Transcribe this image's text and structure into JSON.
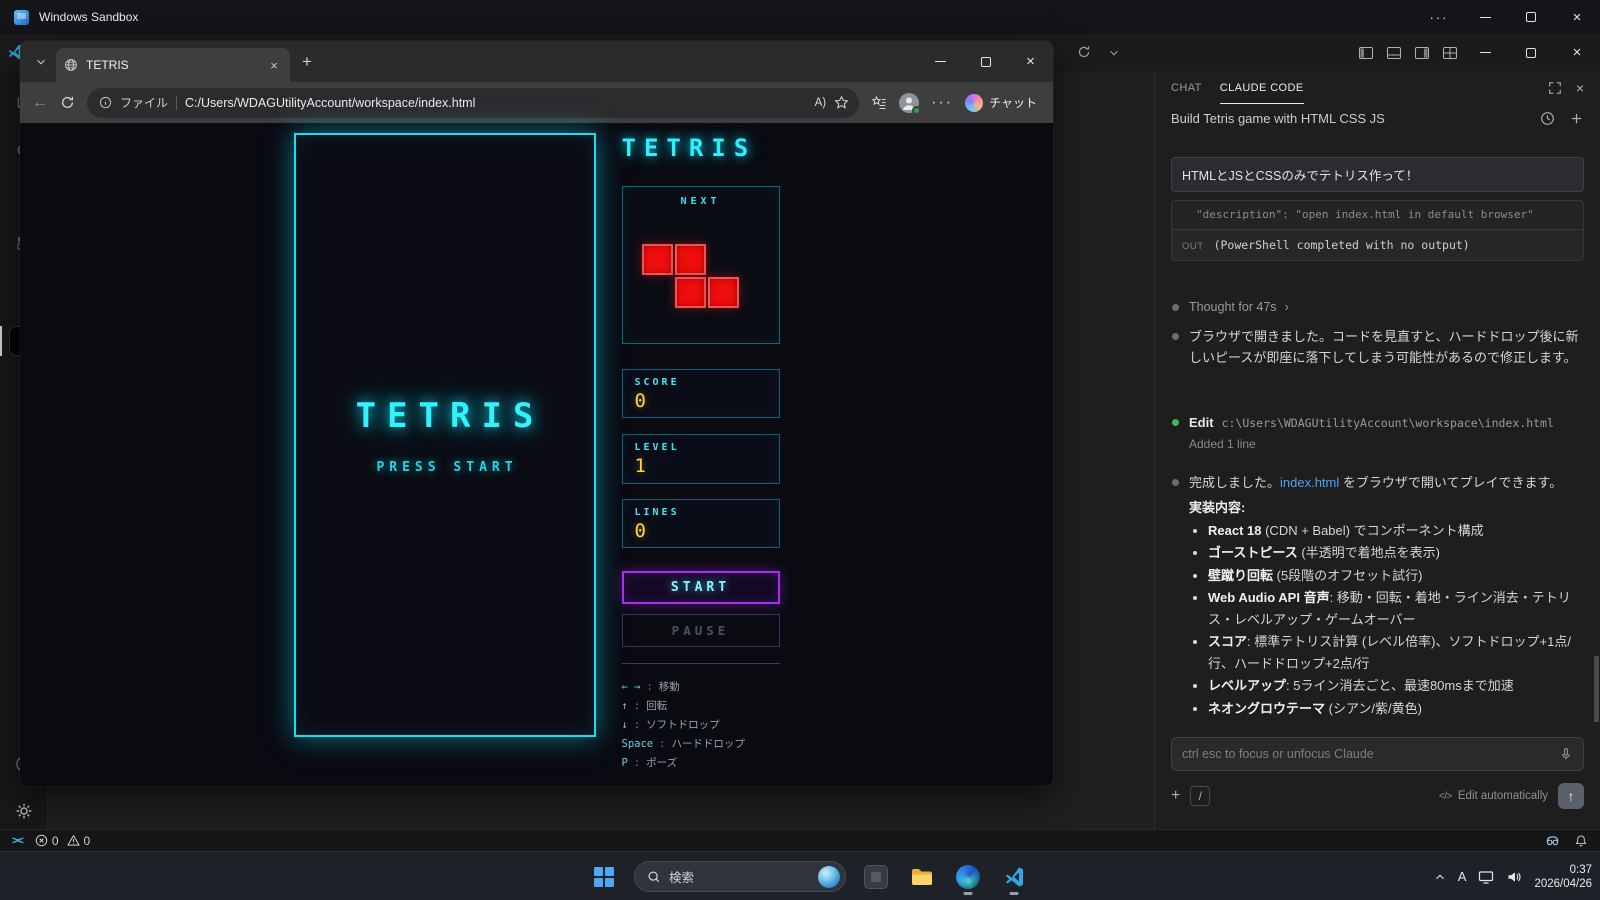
{
  "sandbox": {
    "title": "Windows Sandbox"
  },
  "browser": {
    "tab_title": "TETRIS",
    "address_scheme": "ファイル",
    "address_url": "C:/Users/WDAGUtilityAccount/workspace/index.html",
    "copilot_label": "チャット"
  },
  "tetris": {
    "side_title": "TETRIS",
    "board_title": "TETRIS",
    "board_subtitle": "PRESS START",
    "next_label": "NEXT",
    "stats": [
      {
        "label": "SCORE",
        "value": "0"
      },
      {
        "label": "LEVEL",
        "value": "1"
      },
      {
        "label": "LINES",
        "value": "0"
      }
    ],
    "start_label": "START",
    "pause_label": "PAUSE",
    "controls_sep": ":",
    "controls": [
      {
        "key": "← →",
        "desc": "移動"
      },
      {
        "key": "↑",
        "desc": "回転"
      },
      {
        "key": "↓",
        "desc": "ソフトドロップ"
      },
      {
        "key": "Space",
        "desc": "ハードドロップ"
      },
      {
        "key": "P",
        "desc": "ポーズ"
      }
    ],
    "colors": {
      "accent": "#00e5ff",
      "purple": "#ab2df5",
      "value_yellow": "#ffd43c",
      "block_red": "#ee0d0d"
    }
  },
  "claude_panel": {
    "tabs": [
      {
        "label": "CHAT"
      },
      {
        "label": "CLAUDE CODE"
      }
    ],
    "session_title": "Build Tetris game with HTML CSS JS",
    "prompt": "HTMLとJSとCSSのみでテトリス作って！",
    "tool_block": {
      "code_line": "\"description\": \"open index.html in default browser\"",
      "out_label": "OUT",
      "out_text": "(PowerShell completed with no output)"
    },
    "thought": "Thought for 47s",
    "message1": "ブラウザで開きました。コードを見直すと、ハードドロップ後に新しいピースが即座に落下してしまう可能性があるので修正します。",
    "edit": {
      "label": "Edit",
      "path": "c:\\Users\\WDAGUtilityAccount\\workspace\\index.html",
      "detail": "Added 1 line"
    },
    "message2_pre": "完成しました。",
    "message2_link": "index.html",
    "message2_post": " をブラウザで開いてプレイできます。",
    "impl_heading": "実装内容:",
    "impl_items": [
      {
        "bold": "React 18",
        "rest": " (CDN + Babel) でコンポーネント構成"
      },
      {
        "bold": "ゴーストピース",
        "rest": " (半透明で着地点を表示)"
      },
      {
        "bold": "壁蹴り回転",
        "rest": " (5段階のオフセット試行)"
      },
      {
        "bold": "Web Audio API 音声",
        "rest": ": 移動・回転・着地・ライン消去・テトリス・レベルアップ・ゲームオーバー"
      },
      {
        "bold": "スコア",
        "rest": ": 標準テトリス計算 (レベル倍率)、ソフトドロップ+1点/行、ハードドロップ+2点/行"
      },
      {
        "bold": "レベルアップ",
        "rest": ": 5ライン消去ごと、最速80msまで加速"
      },
      {
        "bold": "ネオングロウテーマ",
        "rest": " (シアン/紫/黄色)"
      }
    ],
    "input_placeholder": "ctrl esc to focus or unfocus Claude",
    "edit_mode_label": "Edit automatically"
  },
  "statusbar": {
    "errors": "0",
    "warnings": "0"
  },
  "taskbar": {
    "search_placeholder": "検索",
    "ime": "A",
    "time": "0:37",
    "date": "2026/04/26"
  },
  "icons": {
    "more": "···",
    "close": "×",
    "chevron_right": "›",
    "claude_logo": "»",
    "remote": "><",
    "read_aloud": "A)",
    "plus": "+",
    "slash": "/",
    "code_tag": "</>",
    "send_arrow": "↑",
    "back_arrow": "←"
  }
}
